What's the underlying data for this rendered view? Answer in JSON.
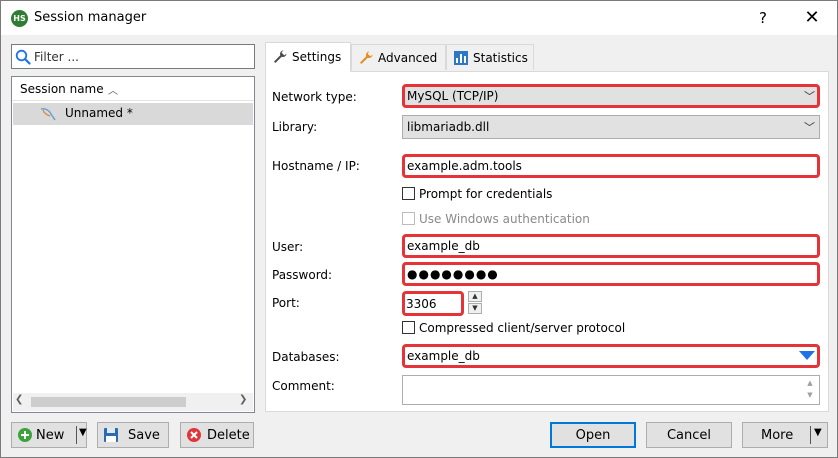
{
  "window": {
    "title": "Session manager",
    "app_icon_text": "HS",
    "help_label": "?",
    "close_label": "✕"
  },
  "left_pane": {
    "filter_placeholder": "Filter ...",
    "column_header": "Session name",
    "sessions": [
      {
        "label": "Unnamed *",
        "selected": true
      }
    ]
  },
  "tabs": [
    {
      "label": "Settings",
      "icon": "wrench-icon",
      "active": true
    },
    {
      "label": "Advanced",
      "icon": "wrench-orange-icon",
      "active": false
    },
    {
      "label": "Statistics",
      "icon": "bar-chart-icon",
      "active": false
    }
  ],
  "settings": {
    "network_type_label": "Network type:",
    "network_type_value": "MySQL (TCP/IP)",
    "library_label": "Library:",
    "library_value": "libmariadb.dll",
    "hostname_label": "Hostname / IP:",
    "hostname_value": "example.adm.tools",
    "prompt_credentials_label": "Prompt for credentials",
    "windows_auth_label": "Use Windows authentication",
    "user_label": "User:",
    "user_value": "example_db",
    "password_label": "Password:",
    "password_value": "●●●●●●●●",
    "port_label": "Port:",
    "port_value": "3306",
    "compressed_label": "Compressed client/server protocol",
    "databases_label": "Databases:",
    "databases_value": "example_db",
    "comment_label": "Comment:",
    "comment_value": ""
  },
  "buttons": {
    "new": "New",
    "save": "Save",
    "delete": "Delete",
    "open": "Open",
    "cancel": "Cancel",
    "more": "More"
  },
  "colors": {
    "highlight": "#e53338",
    "accent": "#0078d7",
    "db_arrow": "#1e73e6"
  }
}
